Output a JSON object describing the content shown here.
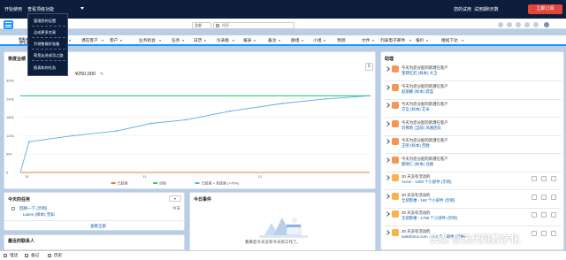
{
  "topbar": {
    "get_started": "开始使用",
    "features": "查看顶级功能",
    "trial_text": "您的试用",
    "trial_days": "试用期8天数",
    "upgrade_button": "立即订阅",
    "bg_color": "#0d1e3d",
    "accent": "#e2453b"
  },
  "dropdown_menu": {
    "items": [
      "管理您的设置",
      "达成更多交易",
      "为销售做好准备",
      "帮您走进成功之路",
      "图表和你任务"
    ]
  },
  "search": {
    "scope": "全部",
    "placeholder": "搜索..."
  },
  "nav": {
    "app_title": "销售",
    "tabs": [
      {
        "label": "主页",
        "active": true,
        "caret": false
      },
      {
        "label": "联系人",
        "caret": true
      },
      {
        "label": "潜在客户",
        "caret": true
      },
      {
        "label": "客户",
        "caret": true
      },
      {
        "label": "业务机会",
        "caret": true
      },
      {
        "label": "任务",
        "caret": true
      },
      {
        "label": "日历",
        "caret": true
      },
      {
        "label": "仪表板",
        "caret": true
      },
      {
        "label": "报表",
        "caret": true
      },
      {
        "label": "备注",
        "caret": true
      },
      {
        "label": "群组",
        "caret": true
      },
      {
        "label": "小组",
        "caret": true
      },
      {
        "label": "预测",
        "caret": false
      },
      {
        "label": "文件",
        "caret": true
      },
      {
        "label": "列表电子邮件",
        "caret": true
      },
      {
        "label": "报价",
        "caret": true
      },
      {
        "label": "继续下达",
        "caret": true
      }
    ]
  },
  "quarterly": {
    "title": "季度业绩",
    "goal_label": "¥250,000",
    "refresh_icon": "refresh-icon"
  },
  "chart_data": {
    "type": "line",
    "x_tick_labels": [
      "10",
      "11",
      "12"
    ],
    "y_tick_labels": [
      "300k",
      "240k",
      "180k",
      "120k",
      "60k",
      "0"
    ],
    "ylim": [
      0,
      300000
    ],
    "series": [
      {
        "name": "已结束",
        "color": "#ed7d31",
        "points": [
          [
            0,
            0
          ],
          [
            10,
            0
          ],
          [
            60,
            0
          ],
          [
            110,
            0
          ],
          [
            150,
            0
          ],
          [
            190,
            0
          ],
          [
            240,
            0
          ],
          [
            300,
            0
          ],
          [
            350,
            0
          ],
          [
            400,
            0
          ]
        ]
      },
      {
        "name": "目标",
        "color": "#2ecc71",
        "points": [
          [
            0,
            250000
          ],
          [
            400,
            250000
          ]
        ]
      },
      {
        "name": "已结束 + 未结束 (>70%)",
        "color": "#5aaee8",
        "points": [
          [
            0,
            0
          ],
          [
            10,
            100000
          ],
          [
            60,
            120000
          ],
          [
            110,
            135000
          ],
          [
            150,
            160000
          ],
          [
            190,
            172000
          ],
          [
            240,
            200000
          ],
          [
            300,
            225000
          ],
          [
            350,
            240000
          ],
          [
            400,
            250000
          ]
        ]
      }
    ],
    "legend_position": "bottom",
    "grid": true
  },
  "tasks": {
    "title": "今天的任务",
    "more_icon": "chevron-down-icon",
    "items": [
      {
        "name": "回顾一下 (示例)",
        "who": "Lianm (样本) 无知",
        "date": "今天"
      }
    ],
    "view_all": "查看全部"
  },
  "events": {
    "title": "今日事件",
    "empty_text": "看来您今天没有今天的工作了。"
  },
  "recent": {
    "title": "最近的联系人"
  },
  "assistant": {
    "title": "助理",
    "items": [
      {
        "line1": "今天为您分配的新潜在客户",
        "line2": "邹建红赶 (样本) 大卫",
        "icon_color": "#f49756",
        "actions": false
      },
      {
        "line1": "今天为您分配的新潜在客户",
        "line2": "赵丽娜 (样本) 蔚蓝",
        "icon_color": "#f49756",
        "actions": false
      },
      {
        "line1": "今天为您分配的新潜在客户",
        "line2": "方信 (样本) 艾米",
        "icon_color": "#f49756",
        "actions": false
      },
      {
        "line1": "今天为您分配的新潜在客户",
        "line2": "刘佛哈 (当前) 凤凰团队",
        "icon_color": "#f49756",
        "actions": false
      },
      {
        "line1": "今天为您分配的新潜在客户",
        "line2": "王明 (样本) 百胜",
        "icon_color": "#f49756",
        "actions": false
      },
      {
        "line1": "今天为您分配的新潜在客户",
        "line2": "蔡晓仁 (样本) 北極",
        "icon_color": "#f49756",
        "actions": false
      },
      {
        "line1": "30 天没有活动的",
        "line2": "Acme - 1250 个小部件 (示例)",
        "icon_color": "#f8b44b",
        "actions": true
      },
      {
        "line1": "30 天没有活动的",
        "line2": "全部影楼 - 160 个小部件 (示例)",
        "icon_color": "#f8b44b",
        "actions": true
      },
      {
        "line1": "30 天没有活动的",
        "line2": "全部影楼 - 1750 个小部件 (示例)",
        "icon_color": "#f8b44b",
        "actions": true
      },
      {
        "line1": "30 天没有活动的",
        "line2": "salesforce.com - 200 个小部件 (示例)",
        "icon_color": "#f8b44b",
        "actions": true
      }
    ]
  },
  "bottombar": {
    "phone": "电话",
    "notes": "备记",
    "history": "历史"
  },
  "watermark": "头条 @无代码数字化"
}
